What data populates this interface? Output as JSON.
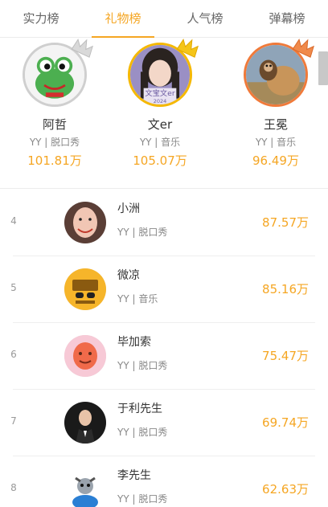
{
  "tabs": [
    {
      "label": "实力榜",
      "active": false
    },
    {
      "label": "礼物榜",
      "active": true
    },
    {
      "label": "人气榜",
      "active": false
    },
    {
      "label": "弹幕榜",
      "active": false
    }
  ],
  "accent_color": "#f5a623",
  "podium": [
    {
      "name": "阿哲",
      "meta": "YY | 脱口秀",
      "value": "101.81万",
      "medal": "silver"
    },
    {
      "name": "文er",
      "meta": "YY | 音乐",
      "value": "105.07万",
      "medal": "gold"
    },
    {
      "name": "王冕",
      "meta": "YY | 音乐",
      "value": "96.49万",
      "medal": "bronze"
    }
  ],
  "list": [
    {
      "rank": "4",
      "name": "小洲",
      "meta": "YY | 脱口秀",
      "value": "87.57万"
    },
    {
      "rank": "5",
      "name": "微凉",
      "meta": "YY | 音乐",
      "value": "85.16万"
    },
    {
      "rank": "6",
      "name": "毕加索",
      "meta": "YY | 脱口秀",
      "value": "75.47万"
    },
    {
      "rank": "7",
      "name": "于利先生",
      "meta": "YY | 脱口秀",
      "value": "69.74万"
    },
    {
      "rank": "8",
      "name": "李先生",
      "meta": "YY | 脱口秀",
      "value": "62.63万"
    }
  ]
}
